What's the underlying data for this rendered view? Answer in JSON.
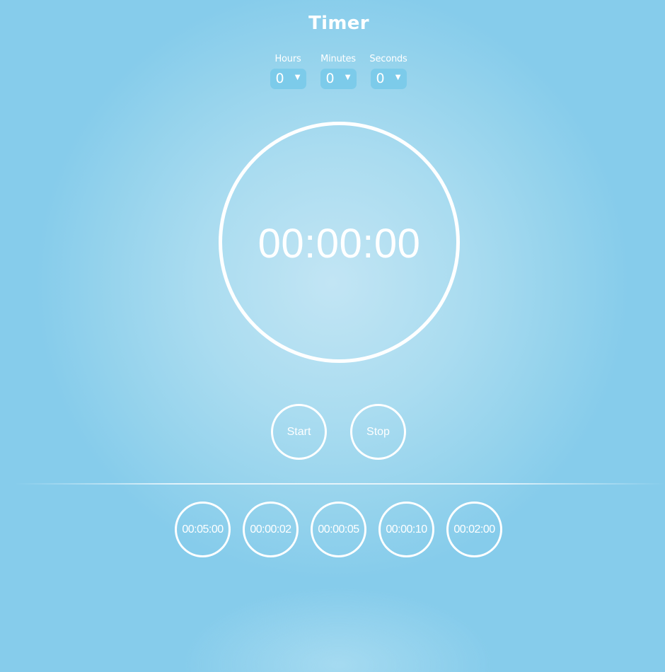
{
  "header": {
    "title": "Timer"
  },
  "pickers": [
    {
      "label": "Hours",
      "value": "0"
    },
    {
      "label": "Minutes",
      "value": "0"
    },
    {
      "label": "Seconds",
      "value": "0"
    }
  ],
  "clock": {
    "display": "00:00:00"
  },
  "controls": {
    "start_label": "Start",
    "stop_label": "Stop"
  },
  "presets": [
    "00:05:00",
    "00:00:02",
    "00:00:05",
    "00:00:10",
    "00:02:00"
  ],
  "icons": {
    "select_caret": "chevron-down-icon"
  },
  "colors": {
    "background": "#a9dbf0",
    "select_fill": "#7ccbea",
    "foreground": "#ffffff"
  }
}
